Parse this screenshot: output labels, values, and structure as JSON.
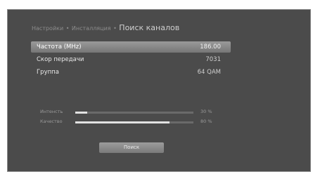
{
  "breadcrumb": {
    "item1": "Настройки",
    "sep": "•",
    "item2": "Инсталляция",
    "current": "Поиск каналов"
  },
  "fields": [
    {
      "label": "Частота (MHz)",
      "value": "186.00"
    },
    {
      "label": "Скор передачи",
      "value": "7031"
    },
    {
      "label": "Группа",
      "value": "64 QAM"
    }
  ],
  "meters": [
    {
      "label": "Интенсть",
      "value": "30 %",
      "level": 0.1
    },
    {
      "label": "Качество",
      "value": "80 %",
      "level": 0.8
    }
  ],
  "search_button": "Поиск",
  "colors": {
    "background": "#4b4b4b",
    "highlight": "#8a8a8a"
  }
}
